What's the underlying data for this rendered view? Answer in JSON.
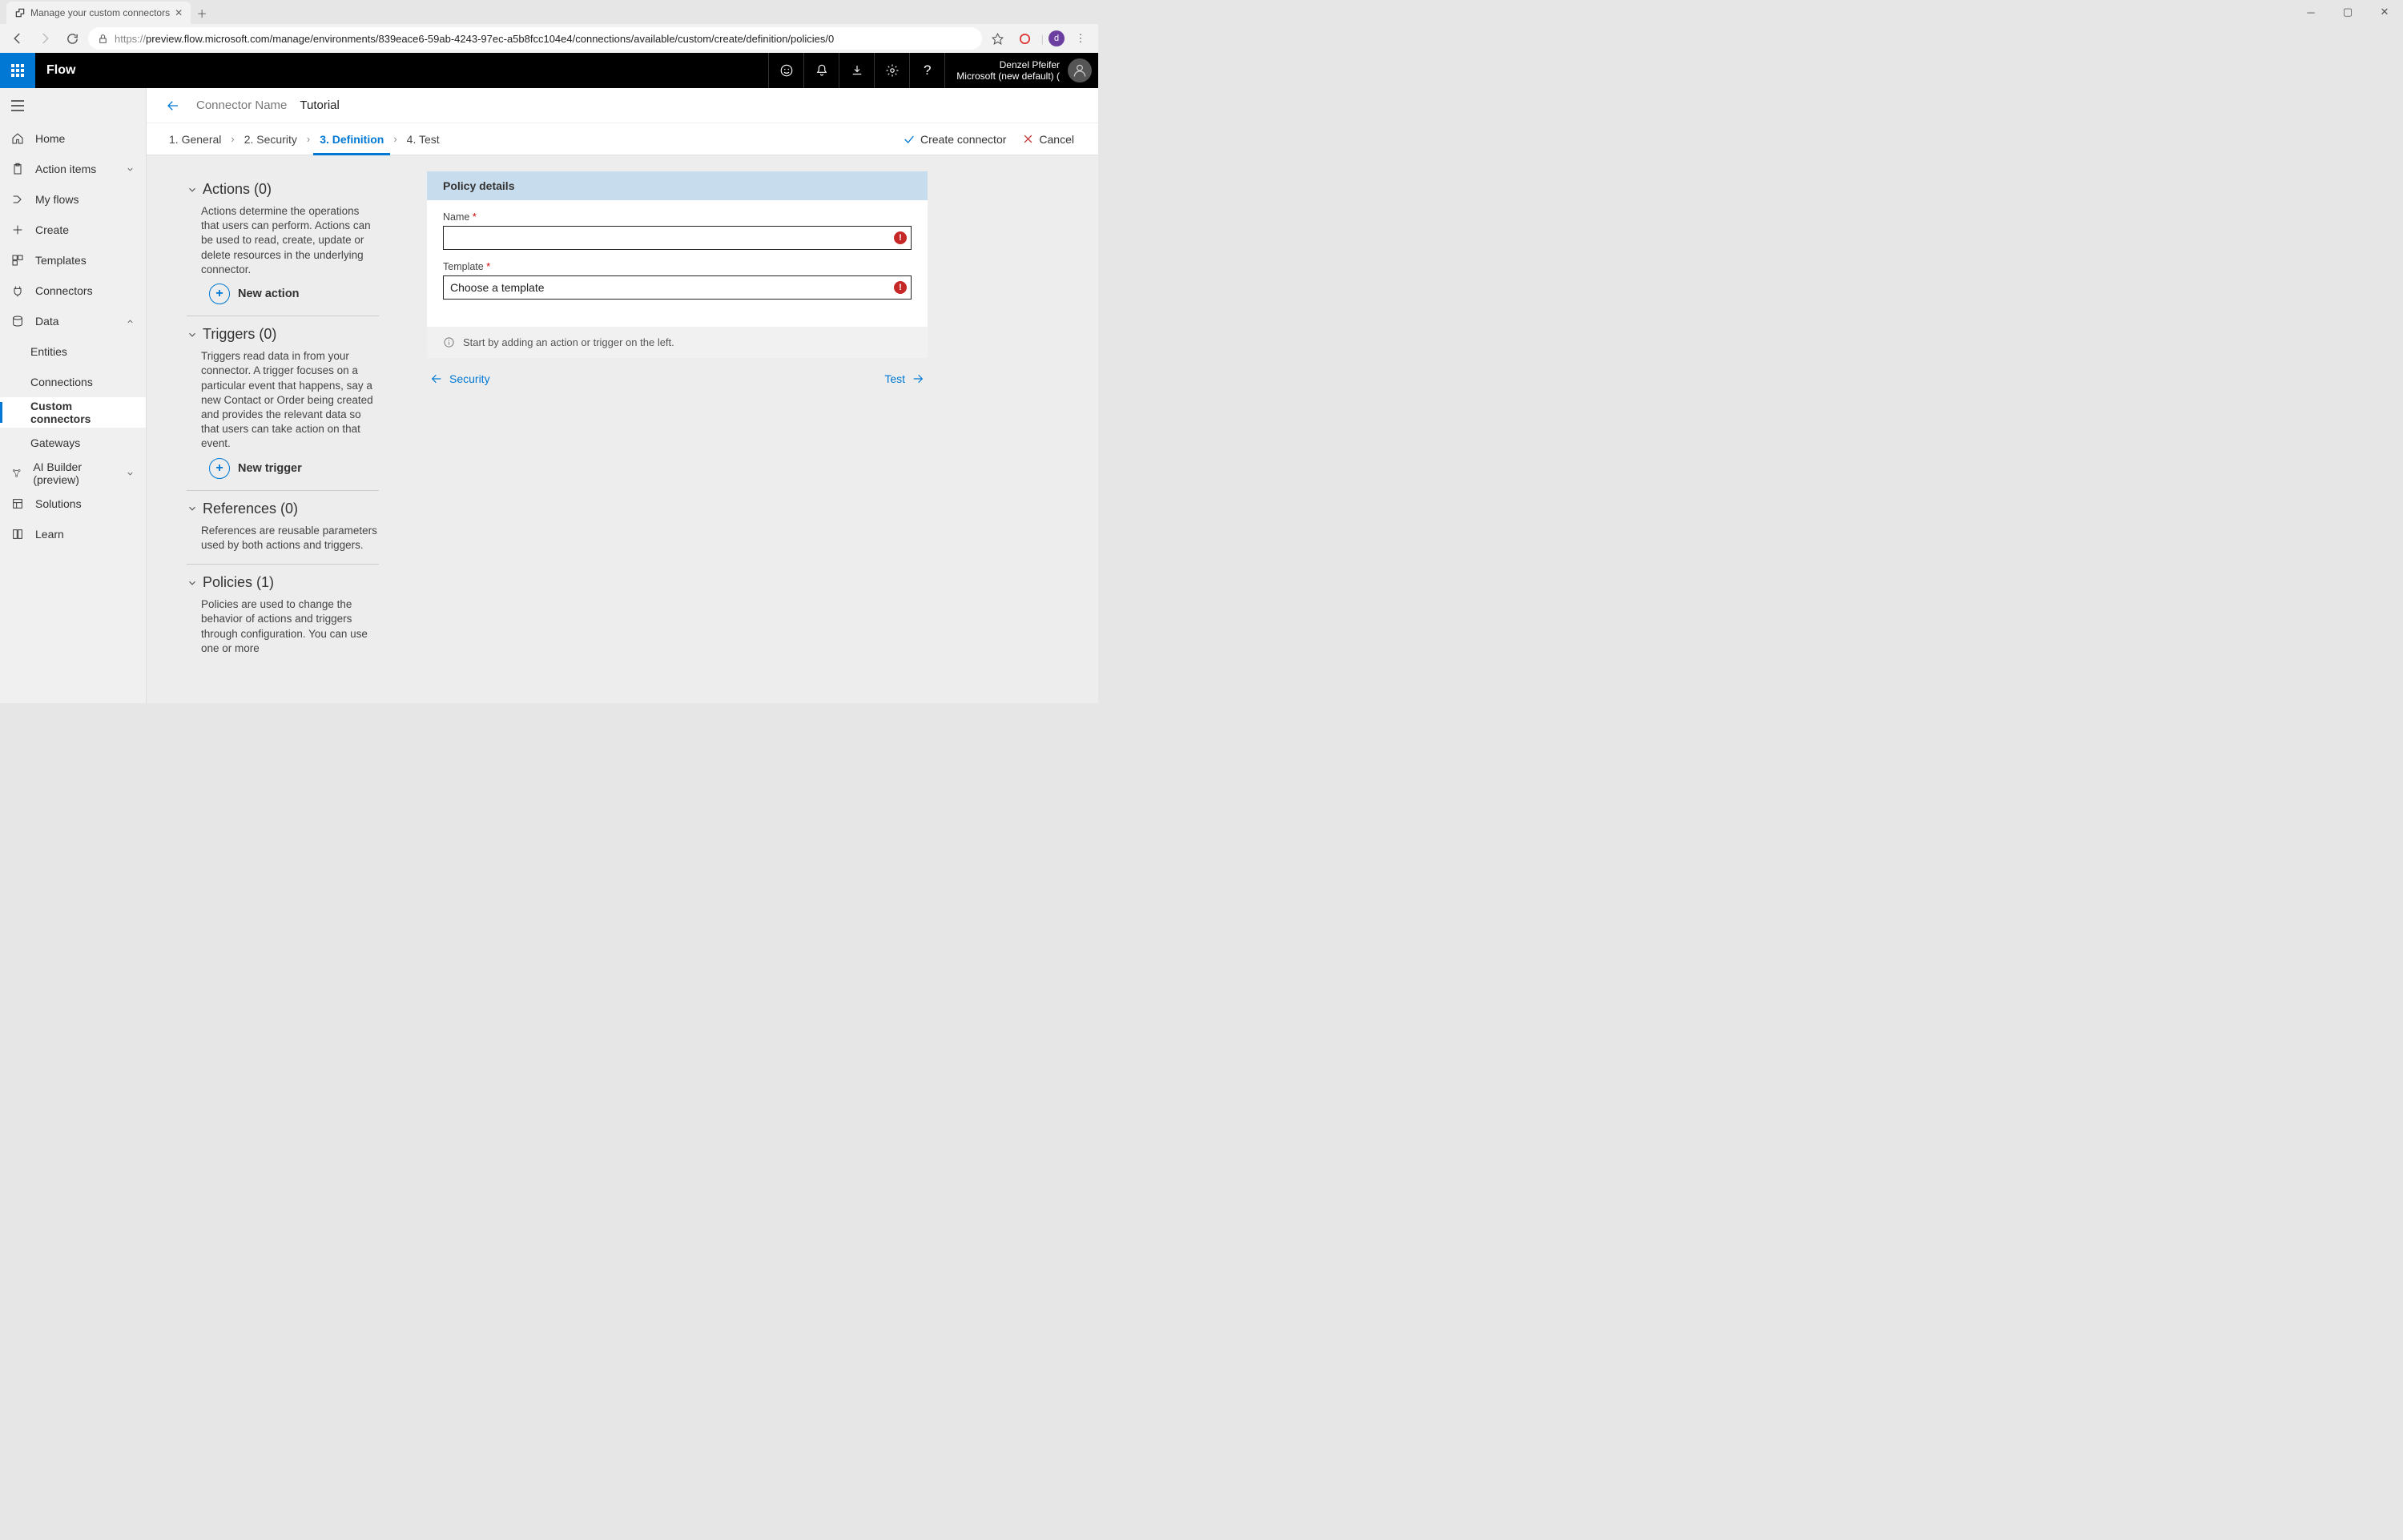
{
  "browser": {
    "tab_title": "Manage your custom connectors",
    "url_proto": "https://",
    "url_rest": "preview.flow.microsoft.com/manage/environments/839eace6-59ab-4243-97ec-a5b8fcc104e4/connections/available/custom/create/definition/policies/0",
    "avatar_letter": "d"
  },
  "header": {
    "app": "Flow",
    "user_name": "Denzel Pfeifer",
    "tenant": "Microsoft (new default) ("
  },
  "sidebar": {
    "home": "Home",
    "action_items": "Action items",
    "my_flows": "My flows",
    "create": "Create",
    "templates": "Templates",
    "connectors": "Connectors",
    "data": "Data",
    "entities": "Entities",
    "connections": "Connections",
    "custom_connectors": "Custom connectors",
    "gateways": "Gateways",
    "ai_builder": "AI Builder (preview)",
    "solutions": "Solutions",
    "learn": "Learn"
  },
  "crumb": {
    "label": "Connector Name",
    "value": "Tutorial"
  },
  "steps": {
    "s1": "1. General",
    "s2": "2. Security",
    "s3": "3. Definition",
    "s4": "4. Test",
    "create": "Create connector",
    "cancel": "Cancel"
  },
  "defs": {
    "actions_title": "Actions (0)",
    "actions_desc": "Actions determine the operations that users can perform. Actions can be used to read, create, update or delete resources in the underlying connector.",
    "new_action": "New action",
    "triggers_title": "Triggers (0)",
    "triggers_desc": "Triggers read data in from your connector. A trigger focuses on a particular event that happens, say a new Contact or Order being created and provides the relevant data so that users can take action on that event.",
    "new_trigger": "New trigger",
    "refs_title": "References (0)",
    "refs_desc": "References are reusable parameters used by both actions and triggers.",
    "policies_title": "Policies (1)",
    "policies_desc": "Policies are used to change the behavior of actions and triggers through configuration. You can use one or more"
  },
  "panel": {
    "title": "Policy details",
    "name_label": "Name",
    "name_value": "",
    "template_label": "Template",
    "template_value": "Choose a template",
    "info": "Start by adding an action or trigger on the left."
  },
  "nav": {
    "prev": "Security",
    "next": "Test"
  }
}
